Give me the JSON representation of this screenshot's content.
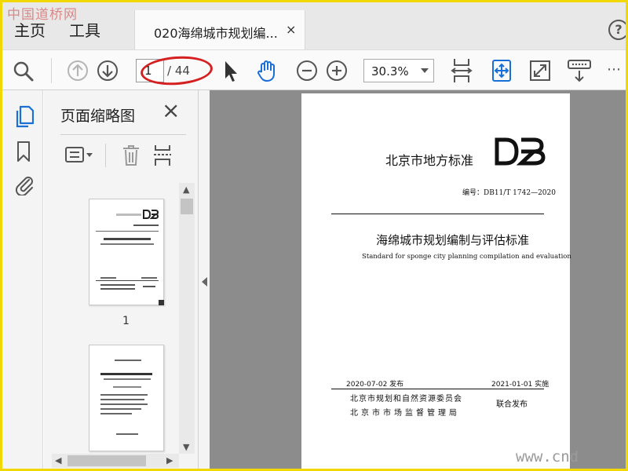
{
  "watermarks": {
    "top_left": "中国道桥网",
    "bottom_right": "www.cnd"
  },
  "menu": {
    "home": "主页",
    "tools": "工具"
  },
  "tab": {
    "title": "020海绵城市规划编...",
    "close": "×"
  },
  "help": "?",
  "toolbar": {
    "current_page": "1",
    "total_pages": "/ 44",
    "zoom": "30.3%",
    "icons": [
      "search-icon",
      "arrow-up-icon",
      "arrow-down-icon",
      "pointer-icon",
      "hand-icon",
      "zoom-out-icon",
      "zoom-in-icon",
      "fit-page-icon",
      "rotate-icon",
      "fullscreen-icon",
      "download-icon"
    ]
  },
  "panel": {
    "title": "页面缩略图",
    "close": "×",
    "thumbnail_pages": [
      "1"
    ]
  },
  "document": {
    "standard_name": "北京市地方标准",
    "logo": "DB",
    "code": "编号：DB11/T 1742—2020",
    "title_cn": "海绵城市规划编制与评估标准",
    "title_en": "Standard for sponge city planning compilation and evaluation",
    "date_issued": "2020-07-02 发布",
    "date_effective": "2021-01-01 实施",
    "org1": "北京市规划和自然资源委员会",
    "org2": "北京市市场监督管理局",
    "joint": "联合发布"
  },
  "colors": {
    "accent_blue": "#1a6fd6",
    "highlight_red": "#d42020",
    "frame_yellow": "#f0d800",
    "doc_bg": "#8c8c8c"
  }
}
